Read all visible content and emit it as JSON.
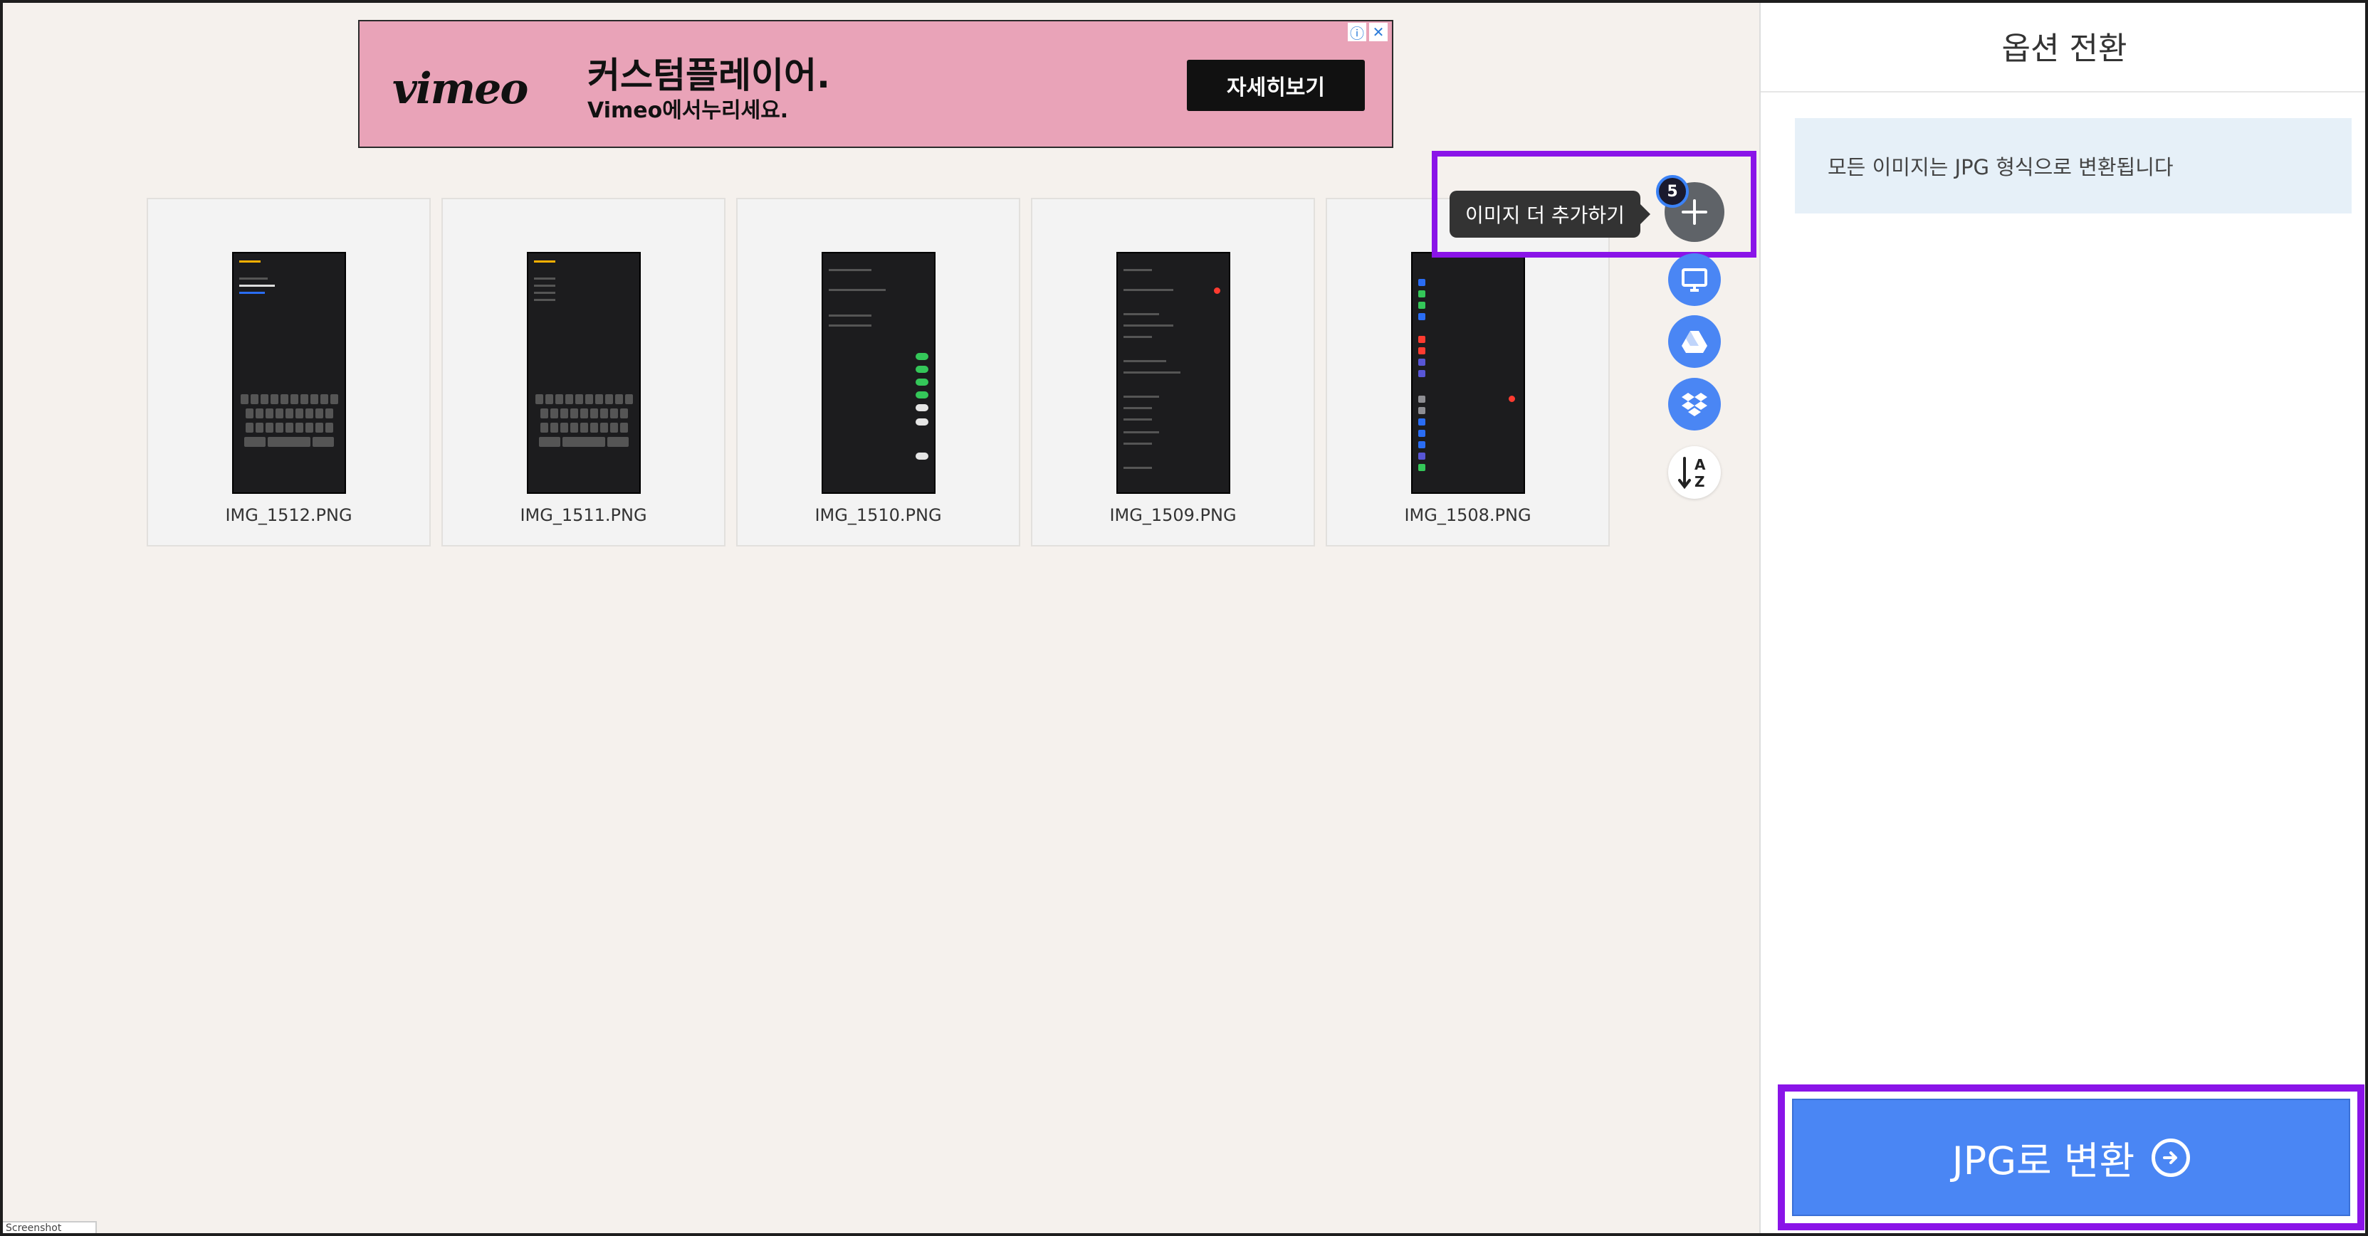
{
  "ad": {
    "logo": "vimeo",
    "headline": "커스텀플레이어.",
    "subline": "Vimeo에서누리세요.",
    "cta": "자세히보기"
  },
  "files": [
    {
      "name": "IMG_1512.PNG",
      "kind": "keyboard-note"
    },
    {
      "name": "IMG_1511.PNG",
      "kind": "keyboard-list"
    },
    {
      "name": "IMG_1510.PNG",
      "kind": "toggles"
    },
    {
      "name": "IMG_1509.PNG",
      "kind": "settings-list"
    },
    {
      "name": "IMG_1508.PNG",
      "kind": "settings-icons"
    }
  ],
  "tools": {
    "add_tooltip": "이미지 더 추가하기",
    "file_count": "5",
    "icons": [
      "plus-icon",
      "monitor-icon",
      "google-drive-icon",
      "dropbox-icon",
      "sort-az-icon"
    ]
  },
  "sidebar": {
    "title": "옵션 전환",
    "info": "모든 이미지는 JPG 형식으로 변환됩니다",
    "convert_label": "JPG로 변환"
  },
  "corner_tab": "Screenshot",
  "colors": {
    "accent": "#4a86f4",
    "highlight": "#8a14e8",
    "background": "#f5f1ed",
    "ad_background": "#e9a3b8"
  }
}
